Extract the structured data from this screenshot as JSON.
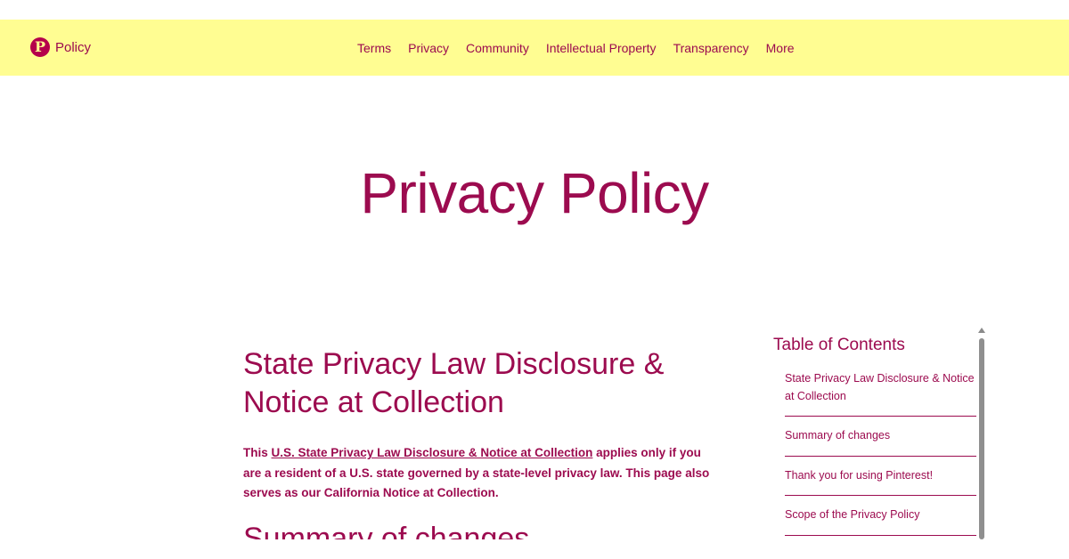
{
  "header": {
    "brand_label": "Policy",
    "logo_glyph": "P",
    "nav": [
      "Terms",
      "Privacy",
      "Community",
      "Intellectual Property",
      "Transparency",
      "More"
    ]
  },
  "page_title": "Privacy Policy",
  "main": {
    "section_title": "State Privacy Law Disclosure & Notice at Collection",
    "intro_prefix": "This ",
    "intro_link": "U.S. State Privacy Law Disclosure & Notice at Collection",
    "intro_suffix": " applies only if you are a resident of a U.S. state governed by a state-level privacy law. This page also serves as our California Notice at Collection.",
    "next_section_title": "Summary of changes"
  },
  "toc": {
    "heading": "Table of Contents",
    "items": [
      "State Privacy Law Disclosure & Notice at Collection",
      "Summary of changes",
      "Thank you for using Pinterest!",
      "Scope of the Privacy Policy"
    ]
  },
  "colors": {
    "header_bg": "#fffd92",
    "text": "#9c0b4f",
    "logo": "#b5004b"
  }
}
